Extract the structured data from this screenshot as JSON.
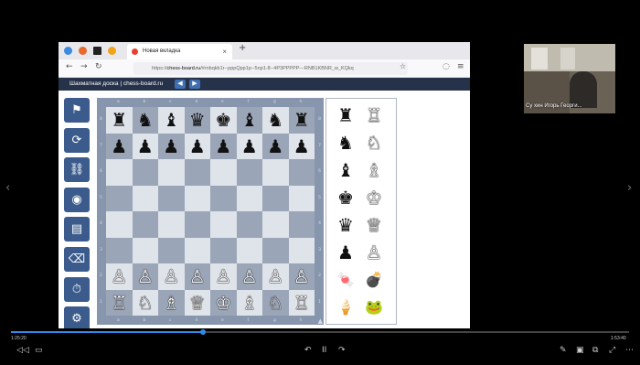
{
  "browser": {
    "tab_title": "Новая вкладка",
    "tab_close": "×",
    "new_tab": "+",
    "url_prefix": "https://",
    "url_domain": "chess-board.ru",
    "url_rest": "/#rnbqkb1r--pppQpp1p--5np1-8--4P3PPPPP---RNB1KBNR_w_KQkq",
    "nav_back": "←",
    "nav_forward": "→",
    "nav_reload": "↻",
    "bookmark_icon": "☆",
    "menu_icon": "≡"
  },
  "page": {
    "site_title": "Шахматная доска | chess-board.ru",
    "prev_arrow": "◀",
    "next_arrow": "▶"
  },
  "toolbar": {
    "tools": [
      {
        "icon": "flag-icon",
        "glyph": "⚑"
      },
      {
        "icon": "refresh-icon",
        "glyph": "⟳"
      },
      {
        "icon": "link-icon",
        "glyph": "⛓"
      },
      {
        "icon": "camera-icon",
        "glyph": "◉"
      },
      {
        "icon": "document-icon",
        "glyph": "▤"
      },
      {
        "icon": "eraser-icon",
        "glyph": "⌫"
      },
      {
        "icon": "timer-icon",
        "glyph": "⏱"
      },
      {
        "icon": "settings-icon",
        "glyph": "⚙"
      }
    ]
  },
  "board": {
    "files": [
      "a",
      "b",
      "c",
      "d",
      "e",
      "f",
      "g",
      "h"
    ],
    "ranks": [
      "8",
      "7",
      "6",
      "5",
      "4",
      "3",
      "2",
      "1"
    ],
    "rows": [
      [
        "♜",
        "♞",
        "♝",
        "♛",
        "♚",
        "♝",
        "♞",
        "♜"
      ],
      [
        "♟",
        "♟",
        "♟",
        "♟",
        "♟",
        "♟",
        "♟",
        "♟"
      ],
      [
        "",
        "",
        "",
        "",
        "",
        "",
        "",
        ""
      ],
      [
        "",
        "",
        "",
        "",
        "",
        "",
        "",
        ""
      ],
      [
        "",
        "",
        "",
        "",
        "",
        "",
        "",
        ""
      ],
      [
        "",
        "",
        "",
        "",
        "",
        "",
        "",
        ""
      ],
      [
        "♙",
        "♙",
        "♙",
        "♙",
        "♙",
        "♙",
        "♙",
        "♙"
      ],
      [
        "♖",
        "♘",
        "♗",
        "♕",
        "♔",
        "♗",
        "♘",
        "♖"
      ]
    ],
    "corner_marker": "▲"
  },
  "palette": {
    "pairs": [
      {
        "black": "♜",
        "white": "♖"
      },
      {
        "black": "♞",
        "white": "♘"
      },
      {
        "black": "♝",
        "white": "♗"
      },
      {
        "black": "♚",
        "white": "♔"
      },
      {
        "black": "♛",
        "white": "♕"
      },
      {
        "black": "♟",
        "white": "♙"
      }
    ],
    "extras": [
      {
        "name": "candy-icon",
        "glyph": "🍬"
      },
      {
        "name": "bomb-icon",
        "glyph": "💣"
      },
      {
        "name": "ice-cream-icon",
        "glyph": "🍦"
      },
      {
        "name": "frog-icon",
        "glyph": "🐸"
      }
    ]
  },
  "webcam": {
    "participant_name": "Су хин Игорь Георги..."
  },
  "player": {
    "time_elapsed": "1:25:20",
    "time_total": "1:53:40",
    "progress": 0.31,
    "left_arrow": "‹",
    "right_arrow": "›",
    "controls_left": [
      "◁◁",
      "▭"
    ],
    "controls_center": [
      "↶",
      "II",
      "↷"
    ],
    "controls_right": [
      "✎",
      "▣",
      "⧉",
      "⤢",
      "⋯"
    ]
  },
  "colors": {
    "board_light": "#dfe3ea",
    "board_dark": "#9aa5b8",
    "board_frame": "#8796ad",
    "tool_button": "#3b5b8c",
    "page_header": "#26324a",
    "progress_accent": "#2f8bea"
  }
}
